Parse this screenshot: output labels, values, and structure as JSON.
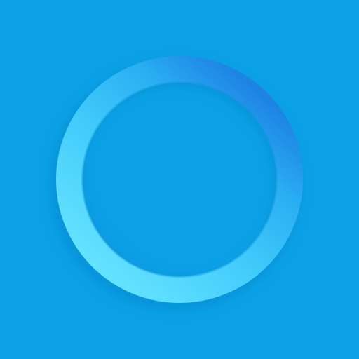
{
  "colors": {
    "background": "#0ba1e6",
    "ring_light": "#5fdcff",
    "ring_mid": "#35c3f8",
    "ring_dark": "#1f86e6"
  },
  "icon": {
    "name": "circle-ring-icon"
  }
}
